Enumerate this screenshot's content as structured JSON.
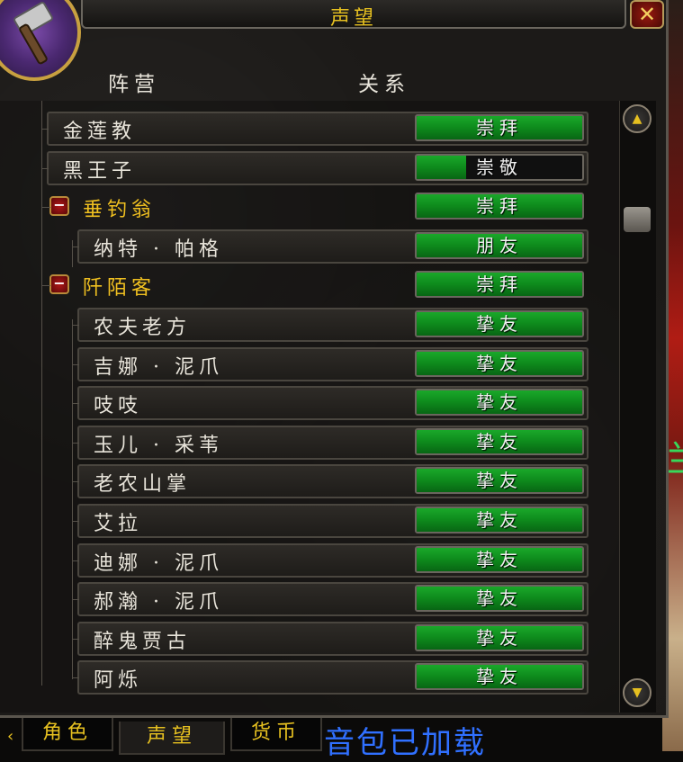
{
  "window": {
    "title": "声望",
    "close_glyph": "✕"
  },
  "columns": {
    "faction": "阵营",
    "standing": "关系"
  },
  "rows": [
    {
      "name": "金莲教",
      "standing": "崇拜",
      "progress": 1.0,
      "header": false,
      "level": 0
    },
    {
      "name": "黑王子",
      "standing": "崇敬",
      "progress": 0.3,
      "header": false,
      "level": 0
    },
    {
      "name": "垂钓翁",
      "standing": "崇拜",
      "progress": 1.0,
      "header": true,
      "level": 0
    },
    {
      "name": "纳特 · 帕格",
      "standing": "朋友",
      "progress": 1.0,
      "header": false,
      "level": 1
    },
    {
      "name": "阡陌客",
      "standing": "崇拜",
      "progress": 1.0,
      "header": true,
      "level": 0
    },
    {
      "name": "农夫老方",
      "standing": "挚友",
      "progress": 1.0,
      "header": false,
      "level": 1
    },
    {
      "name": "吉娜 · 泥爪",
      "standing": "挚友",
      "progress": 1.0,
      "header": false,
      "level": 1
    },
    {
      "name": "吱吱",
      "standing": "挚友",
      "progress": 1.0,
      "header": false,
      "level": 1
    },
    {
      "name": "玉儿 · 采苇",
      "standing": "挚友",
      "progress": 1.0,
      "header": false,
      "level": 1
    },
    {
      "name": "老农山掌",
      "standing": "挚友",
      "progress": 1.0,
      "header": false,
      "level": 1
    },
    {
      "name": "艾拉",
      "standing": "挚友",
      "progress": 1.0,
      "header": false,
      "level": 1
    },
    {
      "name": "迪娜 · 泥爪",
      "standing": "挚友",
      "progress": 1.0,
      "header": false,
      "level": 1
    },
    {
      "name": "郝瀚 · 泥爪",
      "standing": "挚友",
      "progress": 1.0,
      "header": false,
      "level": 1
    },
    {
      "name": "醉鬼贾古",
      "standing": "挚友",
      "progress": 1.0,
      "header": false,
      "level": 1
    },
    {
      "name": "阿烁",
      "standing": "挚友",
      "progress": 1.0,
      "header": false,
      "level": 1
    }
  ],
  "tabs": [
    {
      "label": "角色",
      "active": false
    },
    {
      "label": "声望",
      "active": true
    },
    {
      "label": "货币",
      "active": false
    }
  ],
  "addon_message": "音包已加载",
  "colors": {
    "standing_fill": "#0e8a1c",
    "header_text": "#f0c020",
    "title_text": "#e6c020"
  }
}
